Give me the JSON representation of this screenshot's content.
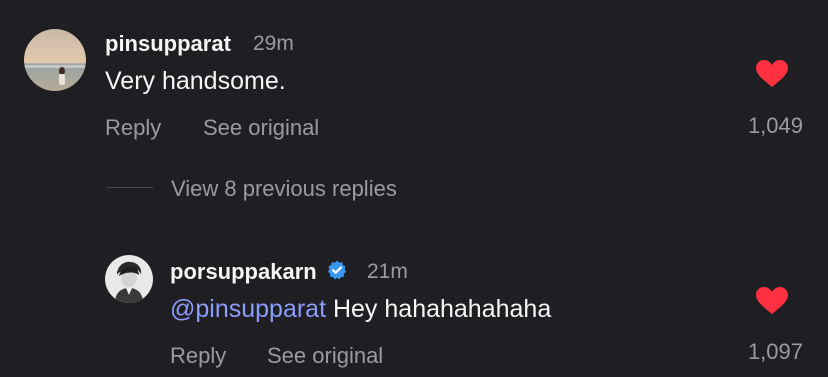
{
  "comment": {
    "username": "pinsupparat",
    "time": "29m",
    "text": "Very handsome.",
    "reply_label": "Reply",
    "see_original_label": "See original",
    "like_count": "1,049",
    "avatar_icon": "beach-photo-avatar"
  },
  "view_replies_label": "View 8 previous replies",
  "reply": {
    "username": "porsuppakarn",
    "verified": true,
    "time": "21m",
    "mention": "@pinsupparat",
    "text": " Hey hahahahahaha",
    "reply_label": "Reply",
    "see_original_label": "See original",
    "like_count": "1,097",
    "avatar_icon": "grayscale-portrait-avatar"
  },
  "colors": {
    "background": "#1f1f23",
    "heart": "#ff3040",
    "verified": "#3897f0",
    "mention": "#8a9cff",
    "secondary_text": "#9a9aa1"
  }
}
